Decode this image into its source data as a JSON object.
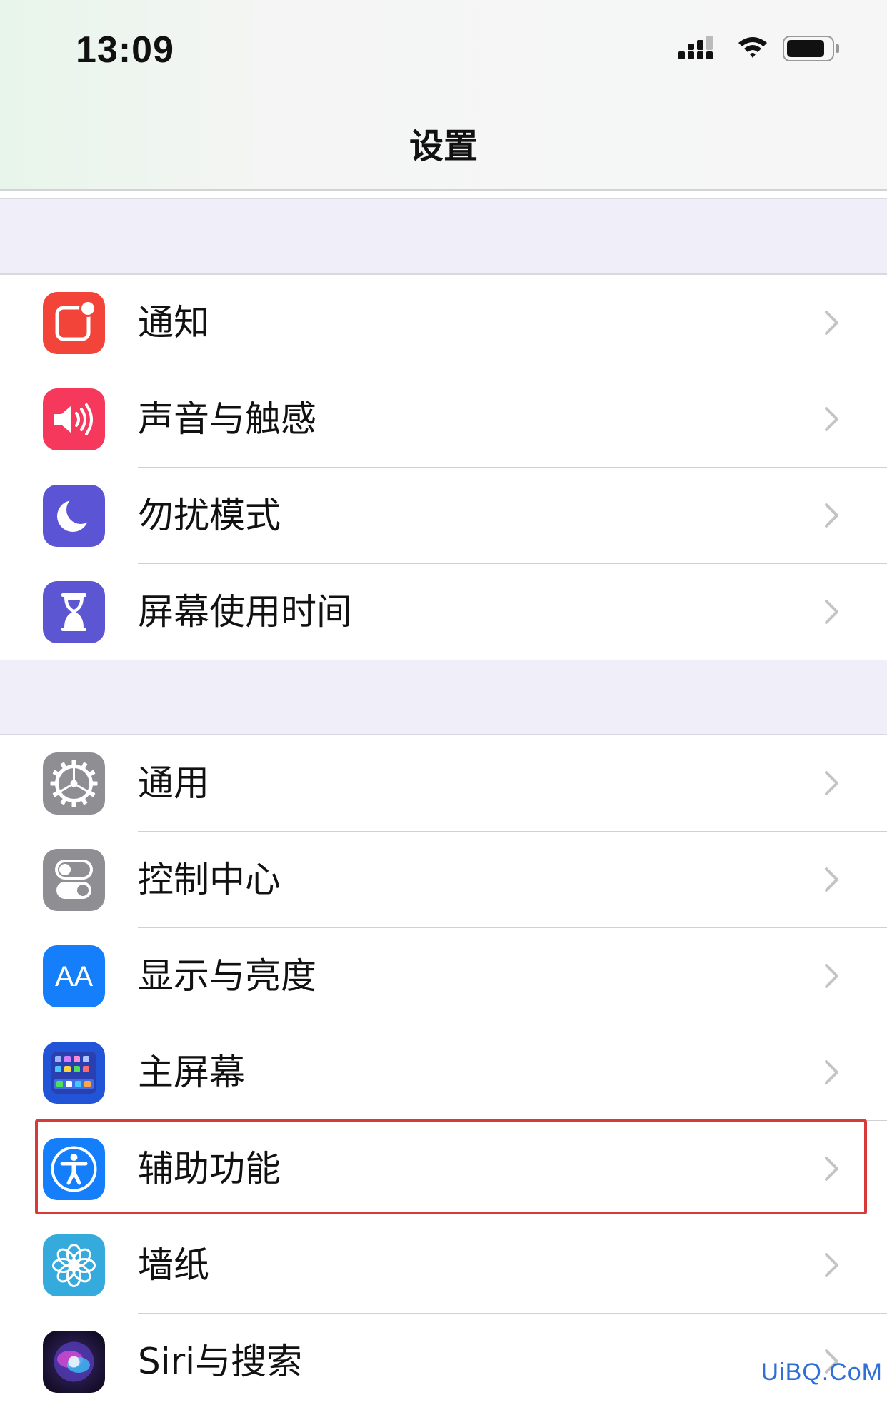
{
  "status_bar": {
    "time": "13:09"
  },
  "header": {
    "title": "设置"
  },
  "colors": {
    "notifications": "#f24438",
    "sounds": "#f5385c",
    "dnd": "#5b55d6",
    "screen_time": "#5c56d2",
    "general": "#8e8e93",
    "control_center": "#8e8e93",
    "display": "#147efb",
    "home_screen": "#2154d6",
    "accessibility": "#147efb",
    "wallpaper": "#35aadc",
    "highlight": "#d83a3a"
  },
  "groups": [
    {
      "items": [
        {
          "label": "通知",
          "icon": "notifications-icon"
        },
        {
          "label": "声音与触感",
          "icon": "sound-icon"
        },
        {
          "label": "勿扰模式",
          "icon": "moon-icon"
        },
        {
          "label": "屏幕使用时间",
          "icon": "hourglass-icon"
        }
      ]
    },
    {
      "items": [
        {
          "label": "通用",
          "icon": "gear-icon"
        },
        {
          "label": "控制中心",
          "icon": "toggles-icon"
        },
        {
          "label": "显示与亮度",
          "icon": "text-size-icon",
          "icon_text": "AA"
        },
        {
          "label": "主屏幕",
          "icon": "app-grid-icon"
        },
        {
          "label": "辅助功能",
          "icon": "accessibility-icon",
          "highlighted": true
        },
        {
          "label": "墙纸",
          "icon": "flower-icon"
        },
        {
          "label": "Siri与搜索",
          "icon": "siri-icon"
        }
      ]
    }
  ],
  "watermark": "UiBQ.CoM"
}
